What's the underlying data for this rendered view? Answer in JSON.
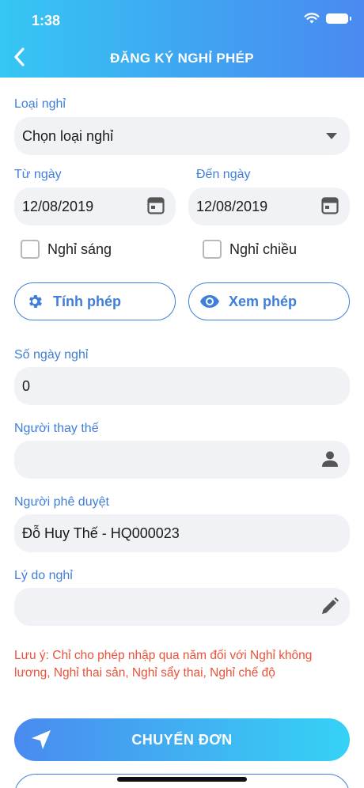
{
  "status_bar": {
    "time": "1:38"
  },
  "header": {
    "title": "ĐĂNG KÝ NGHỈ PHÉP"
  },
  "form": {
    "leave_type": {
      "label": "Loại nghỉ",
      "value": "Chọn loại nghỉ"
    },
    "from_date": {
      "label": "Từ ngày",
      "value": "12/08/2019"
    },
    "to_date": {
      "label": "Đến ngày",
      "value": "12/08/2019"
    },
    "morning": {
      "label": "Nghỉ sáng",
      "checked": false
    },
    "afternoon": {
      "label": "Nghỉ chiều",
      "checked": false
    },
    "calc_button": "Tính phép",
    "view_button": "Xem phép",
    "days": {
      "label": "Số ngày nghỉ",
      "value": "0"
    },
    "substitute": {
      "label": "Người thay thế",
      "value": ""
    },
    "approver": {
      "label": "Người phê duyệt",
      "value": "Đỗ Huy Thế - HQ000023"
    },
    "reason": {
      "label": "Lý do nghỉ",
      "value": ""
    }
  },
  "note": "Lưu ý: Chỉ cho phép nhập qua năm đối với Nghỉ không lương, Nghỉ thai sản, Nghỉ sẩy thai, Nghỉ chế độ",
  "submit_button": "CHUYỂN ĐƠN",
  "colors": {
    "accent": "#3f7fd9",
    "note": "#e8533a",
    "field_bg": "#f1f2f6"
  }
}
